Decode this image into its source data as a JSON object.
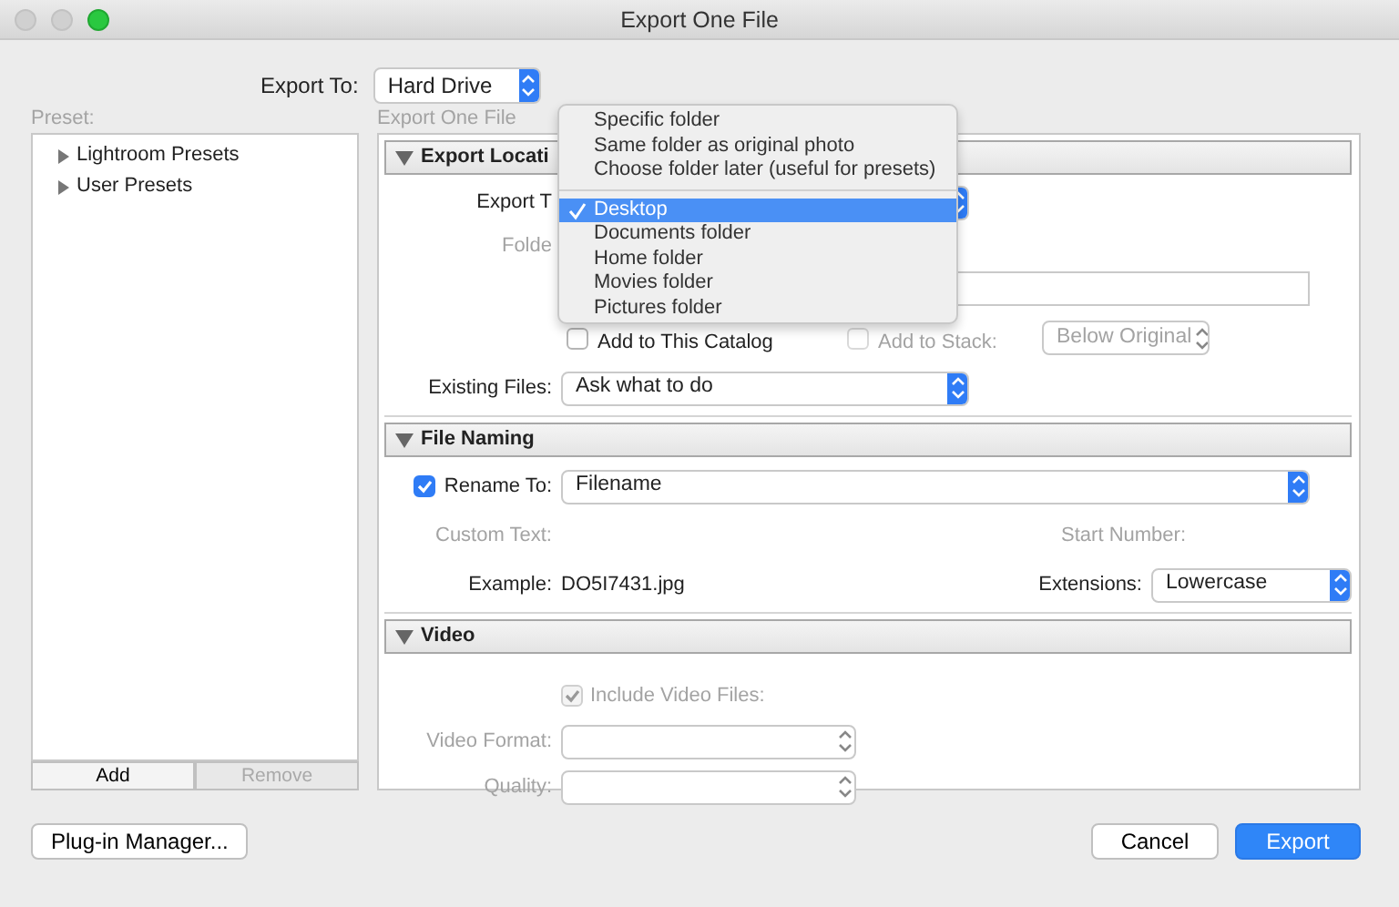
{
  "window": {
    "title": "Export One File"
  },
  "export_to": {
    "label": "Export To:",
    "value": "Hard Drive"
  },
  "presets": {
    "label": "Preset:",
    "items": [
      {
        "label": "Lightroom Presets",
        "expanded": false
      },
      {
        "label": "User Presets",
        "expanded": false
      }
    ],
    "buttons": [
      {
        "label": "Add",
        "disabled": false
      },
      {
        "label": "Remove",
        "disabled": true
      }
    ]
  },
  "panel_title": "Export One File",
  "sections": [
    {
      "title": "Export Locati",
      "expanded": true,
      "rows": [
        {
          "kind": "select",
          "label": "Export T"
        },
        {
          "kind": "label",
          "label": "Folde",
          "disabled": true
        },
        {
          "kind": "field"
        },
        {
          "kind": "checks",
          "label": "Add to This Catalog",
          "checked": false,
          "label_2": "Add to Stack:",
          "checked_2": false,
          "disabled_2": true,
          "value_2": "Below Original"
        },
        {
          "kind": "select",
          "label": "Existing Files:",
          "value": "Ask what to do"
        }
      ]
    },
    {
      "title": "File Naming",
      "expanded": true,
      "rows": [
        {
          "kind": "check_select",
          "label": "Rename To:",
          "checked": true,
          "value": "Filename"
        },
        {
          "kind": "pair",
          "label": "Custom Text:",
          "label_2": "Start Number:",
          "disabled": true
        },
        {
          "kind": "example",
          "label": "Example:",
          "value": "DO5I7431.jpg",
          "label_2": "Extensions:",
          "value_2": "Lowercase"
        }
      ]
    },
    {
      "title": "Video",
      "expanded": true,
      "rows": [
        {
          "kind": "check",
          "label": "Include Video Files:",
          "checked": true,
          "disabled": true
        },
        {
          "kind": "select",
          "label": "Video Format:",
          "disabled": true
        },
        {
          "kind": "select",
          "label": "Quality:",
          "disabled": true
        }
      ]
    }
  ],
  "menu": {
    "groups": [
      [
        {
          "label": "Specific folder",
          "selected": false
        },
        {
          "label": "Same folder as original photo",
          "selected": false
        },
        {
          "label": "Choose folder later (useful for presets)",
          "selected": false
        }
      ],
      [
        {
          "label": "Desktop",
          "selected": true
        },
        {
          "label": "Documents folder",
          "selected": false
        },
        {
          "label": "Home folder",
          "selected": false
        },
        {
          "label": "Movies folder",
          "selected": false
        },
        {
          "label": "Pictures folder",
          "selected": false
        }
      ]
    ]
  },
  "buttons": [
    {
      "label": "Plug-in Manager...",
      "default": false
    },
    {
      "label": "Cancel",
      "default": false
    },
    {
      "label": "Export",
      "default": true
    }
  ]
}
